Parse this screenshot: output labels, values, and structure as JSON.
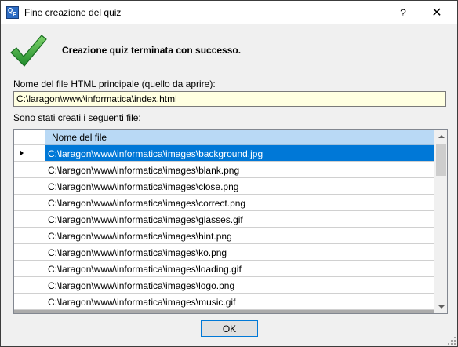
{
  "window": {
    "title": "Fine creazione del quiz",
    "help_symbol": "?",
    "close_symbol": "✕",
    "app_icon_letters": [
      "Q",
      "F"
    ]
  },
  "success_message": "Creazione quiz terminata con successo.",
  "main_file": {
    "label": "Nome del file HTML principale (quello da aprire):",
    "value": "C:\\laragon\\www\\informatica\\index.html"
  },
  "files": {
    "label": "Sono stati creati i seguenti file:",
    "column_header": "Nome del file",
    "rows": [
      "C:\\laragon\\www\\informatica\\images\\background.jpg",
      "C:\\laragon\\www\\informatica\\images\\blank.png",
      "C:\\laragon\\www\\informatica\\images\\close.png",
      "C:\\laragon\\www\\informatica\\images\\correct.png",
      "C:\\laragon\\www\\informatica\\images\\glasses.gif",
      "C:\\laragon\\www\\informatica\\images\\hint.png",
      "C:\\laragon\\www\\informatica\\images\\ko.png",
      "C:\\laragon\\www\\informatica\\images\\loading.gif",
      "C:\\laragon\\www\\informatica\\images\\logo.png",
      "C:\\laragon\\www\\informatica\\images\\music.gif"
    ],
    "selected_index": 0
  },
  "ok_button": "OK",
  "colors": {
    "selection": "#0078d7",
    "header": "#b9d9f5",
    "input_background": "#ffffe1",
    "check": "#3aa63a"
  }
}
